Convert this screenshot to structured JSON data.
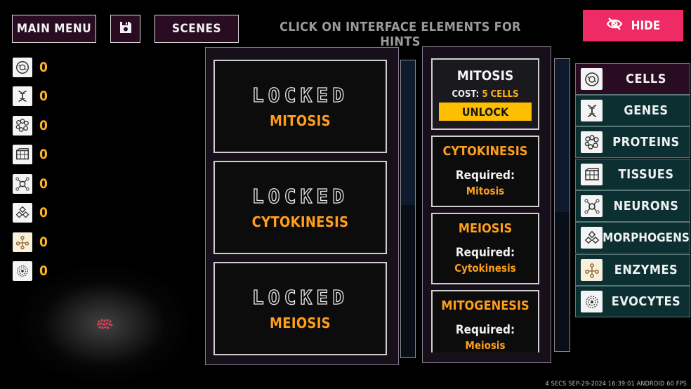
{
  "top_bar": {
    "main_menu_label": "MAIN MENU",
    "save_icon": "floppy-disk-icon",
    "scenes_label": "SCENES",
    "hint": "CLICK ON INTERFACE ELEMENTS FOR HINTS",
    "hide_label": "HIDE",
    "hide_icon": "eye-slash-icon"
  },
  "resources": [
    {
      "icon": "cell-icon",
      "count": "0"
    },
    {
      "icon": "dna-icon",
      "count": "0"
    },
    {
      "icon": "protein-icon",
      "count": "0"
    },
    {
      "icon": "tissue-icon",
      "count": "0"
    },
    {
      "icon": "neuron-icon",
      "count": "0"
    },
    {
      "icon": "morphogen-icon",
      "count": "0"
    },
    {
      "icon": "enzyme-icon",
      "count": "0"
    },
    {
      "icon": "evocyte-icon",
      "count": "0"
    }
  ],
  "locked_cards": [
    {
      "status": "LOCKED",
      "name": "MITOSIS"
    },
    {
      "status": "LOCKED",
      "name": "CYTOKINESIS"
    },
    {
      "status": "LOCKED",
      "name": "MEIOSIS"
    }
  ],
  "selected_upgrade": {
    "title": "MITOSIS",
    "cost_label": "COST:",
    "cost_value": "5 CELLS",
    "unlock_label": "UNLOCK"
  },
  "upgrades": [
    {
      "title": "CYTOKINESIS",
      "required_label": "Required:",
      "required": "Mitosis"
    },
    {
      "title": "MEIOSIS",
      "required_label": "Required:",
      "required": "Cytokinesis"
    },
    {
      "title": "MITOGENESIS",
      "required_label": "Required:",
      "required": "Meiosis"
    }
  ],
  "categories": [
    {
      "label": "CELLS",
      "icon": "cell-icon",
      "active": true
    },
    {
      "label": "GENES",
      "icon": "dna-icon",
      "active": false
    },
    {
      "label": "PROTEINS",
      "icon": "protein-icon",
      "active": false
    },
    {
      "label": "TISSUES",
      "icon": "tissue-icon",
      "active": false
    },
    {
      "label": "NEURONS",
      "icon": "neuron-icon",
      "active": false
    },
    {
      "label": "MORPHOGENS",
      "icon": "morphogen-icon",
      "active": false
    },
    {
      "label": "ENZYMES",
      "icon": "enzyme-icon",
      "active": false
    },
    {
      "label": "EVOCYTES",
      "icon": "evocyte-icon",
      "active": false
    }
  ],
  "status_bar": "4 SECS  SEP-29-2024 16:39:01  ANDROID  60 FPS",
  "colors": {
    "accent_orange": "#ff9f1a",
    "count_yellow": "#ffb51c",
    "hide_pink": "#ee2b64",
    "unlock_yellow": "#ffbf00",
    "category_teal": "#0c3032",
    "active_purple": "#2a0c22"
  }
}
